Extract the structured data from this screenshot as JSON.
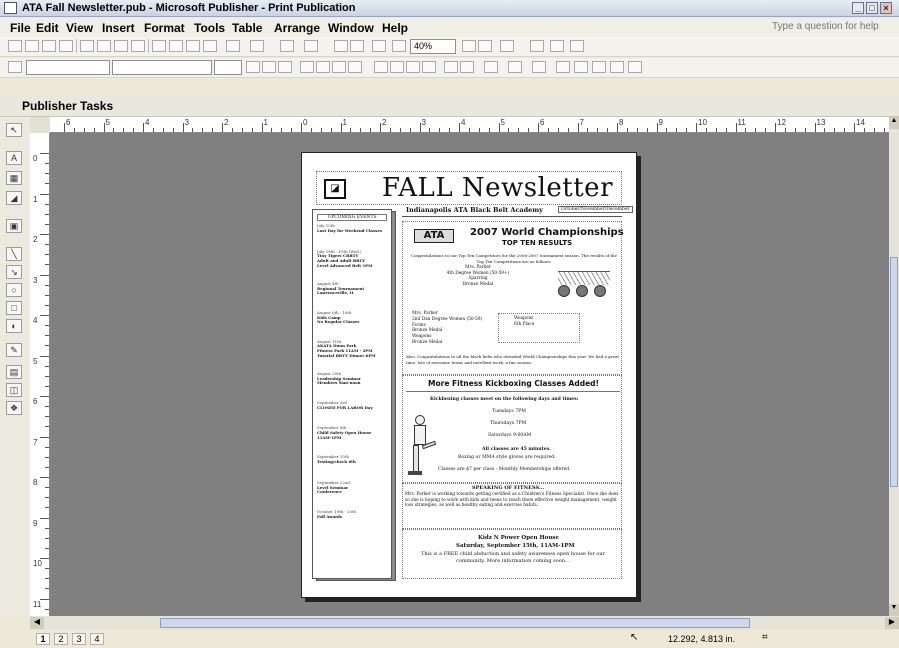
{
  "window": {
    "title": "ATA Fall Newsletter.pub - Microsoft Publisher - Print Publication"
  },
  "menu": {
    "items": [
      "File",
      "Edit",
      "View",
      "Insert",
      "Format",
      "Tools",
      "Table",
      "Arrange",
      "Window",
      "Help"
    ],
    "ask_placeholder": "Type a question for help"
  },
  "toolbar": {
    "zoom": "40%",
    "style_value": "",
    "font_value": "",
    "size_value": ""
  },
  "taskpane": {
    "label": "Publisher Tasks"
  },
  "ruler": {
    "h_labels": [
      "6",
      "5",
      "4",
      "3",
      "2",
      "1",
      "0",
      "1",
      "2",
      "3",
      "4",
      "5",
      "6",
      "7",
      "8",
      "9",
      "10",
      "11",
      "12",
      "13",
      "14"
    ],
    "v_labels": [
      "0",
      "1",
      "2",
      "3",
      "4",
      "5",
      "6",
      "7",
      "8",
      "9",
      "10",
      "11"
    ]
  },
  "newsletter": {
    "title": "FALL Newsletter",
    "academy": "Indianapolis ATA Black Belt Academy",
    "org_logo": "ATA",
    "headline": "2007 World Championships",
    "subhead": "TOP TEN RESULTS",
    "congrats": "Congratulations to our Top Ten Competitors for the 2006-2007 tournament season. The results of the Top Ten Competitions are as follows:",
    "results_a": [
      "Mrs. Parker",
      "4th Degree Women (50-59+)",
      "Sparring",
      "Bronze Medal"
    ],
    "results_b": [
      "Mrs. Parker",
      "2nd Dan Degree Women (50-59)",
      "Forms",
      "Bronze Medal",
      "Weapons",
      "Bronze Medal"
    ],
    "results_c": [
      "Weapons",
      "6th Place"
    ],
    "congrats2": "Also, Congratulations to all the black belts who attended World Championships this year. We had a great time, lots of awesome forms and excellent work, a fun season.",
    "fitness_title": "More Fitness Kickboxing Classes Added!",
    "fitness_intro": "Kickboxing classes meet on the following days and times:",
    "fitness_days": [
      "Tuesdays 7PM",
      "Thursdays 7PM",
      "Saturdays 9:00AM"
    ],
    "fitness_note": "All classes are 45 minutes.",
    "fitness_note2": "Boxing or MMA style gloves are required.",
    "fitness_price": "Classes are $7 per class - Monthly Memberships offered.",
    "speaking_title": "SPEAKING OF FITNESS…",
    "speaking_text": "Mrs. Parker is working towards getting certified as a Children's Fitness Specialist. Once she does so she is hoping to work with kids and teens to teach them effective weight management, weight loss strategies, as well as healthy eating and exercise habits.",
    "kidz_title": "Kidz N Power Open House",
    "kidz_date": "Saturday, September 15th, 11AM-1PM",
    "kidz_text": "This is a FREE child abduction and safety awareness open house for our community. More information coming soon…",
    "sidebar_header": "UPCOMING EVENTS",
    "events": [
      "July 15th|Last Day for Weekend Classes",
      "July 18th - 19th (Wed.)|Tiny Tigers CBBTY|Adult and Adult BBTY|Level Advanced Belt 1PM",
      "August 4th|Regional Tournament|Lawrenceville, IL",
      "August 6th - 10th|Kids Camp|No Regular Classes",
      "August 11th|AKATA Dunn Park|Fitness Park 11AM - 2PM|Tutorial BBTY Dinner 6PM",
      "August 25th|Leadership Seminar|Members 9am-noon",
      "September 3rd|CLOSED FOR LABOR Day",
      "September 8th|Child Safety Open House|11AM-1PM",
      "September 15th|Testing/check 6th",
      "September 22nd|Level Seminar|Conference",
      "October 19th - 20th|Fall Awards"
    ],
    "date_box": "October/November/December"
  },
  "status": {
    "pages": [
      "1",
      "2",
      "3",
      "4"
    ],
    "coords": "12.292, 4.813 in."
  }
}
